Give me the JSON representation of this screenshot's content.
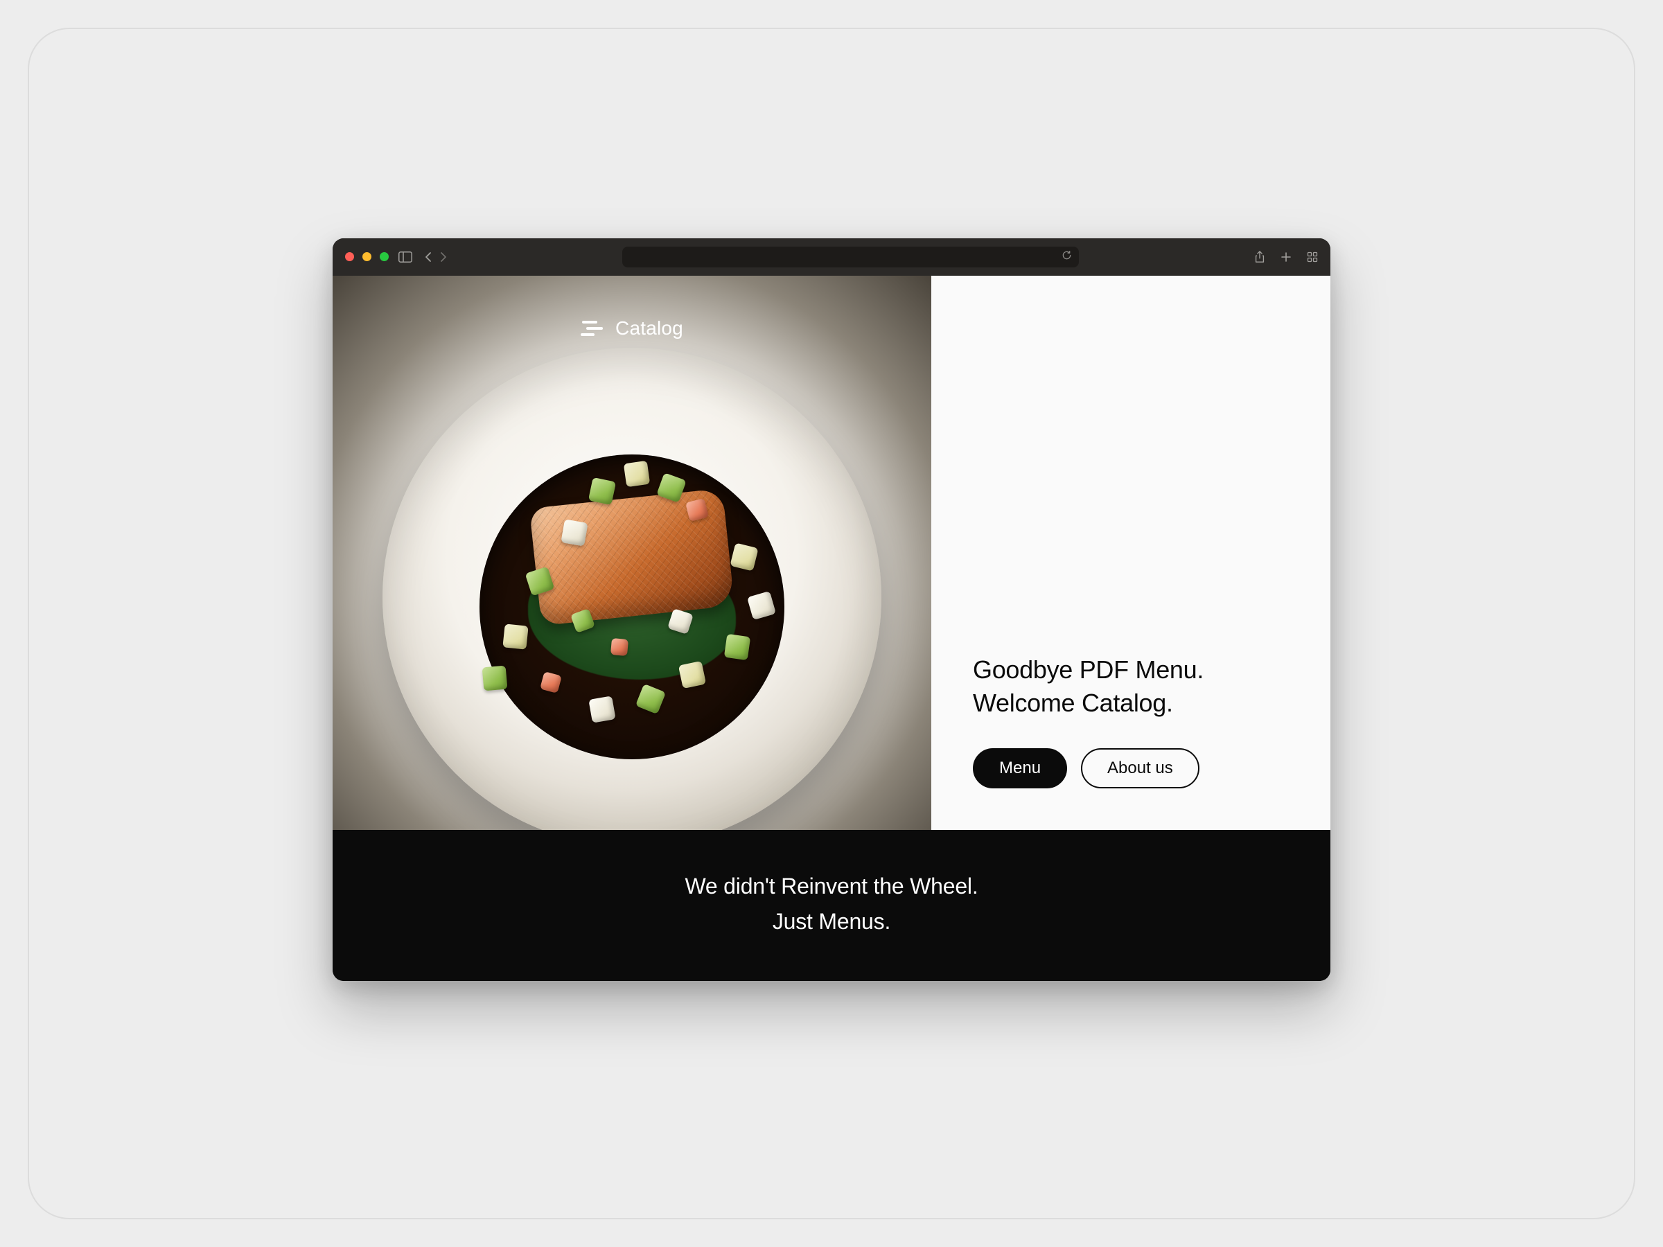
{
  "brand": {
    "name": "Catalog"
  },
  "hero": {
    "headline_line1": "Goodbye PDF Menu.",
    "headline_line2": "Welcome Catalog.",
    "cta_primary": "Menu",
    "cta_secondary": "About us"
  },
  "band": {
    "line1": "We didn't Reinvent the Wheel.",
    "line2": "Just Menus."
  },
  "toolbar_icons": {
    "sidebar": "sidebar-icon",
    "back": "chevron-left-icon",
    "forward": "chevron-right-icon",
    "reload": "reload-icon",
    "share": "share-icon",
    "new_tab": "plus-icon",
    "tabs": "grid-icon"
  }
}
